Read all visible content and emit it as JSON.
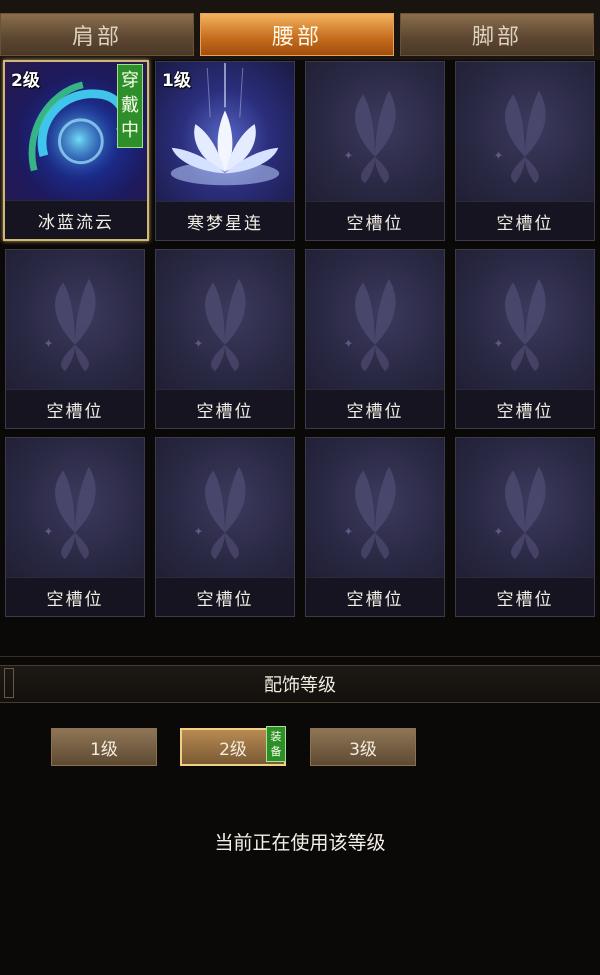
{
  "tabs": [
    {
      "label": "肩部"
    },
    {
      "label": "腰部"
    },
    {
      "label": "脚部"
    }
  ],
  "active_tab": "腰部",
  "slots": [
    {
      "name": "冰蓝流云",
      "level": "2级",
      "wearing": "穿戴中",
      "state": "equipped"
    },
    {
      "name": "寒梦星连",
      "level": "1级",
      "state": "owned"
    },
    {
      "name": "空槽位",
      "state": "empty"
    },
    {
      "name": "空槽位",
      "state": "empty"
    },
    {
      "name": "空槽位",
      "state": "empty"
    },
    {
      "name": "空槽位",
      "state": "empty"
    },
    {
      "name": "空槽位",
      "state": "empty"
    },
    {
      "name": "空槽位",
      "state": "empty"
    },
    {
      "name": "空槽位",
      "state": "empty"
    },
    {
      "name": "空槽位",
      "state": "empty"
    },
    {
      "name": "空槽位",
      "state": "empty"
    },
    {
      "name": "空槽位",
      "state": "empty"
    }
  ],
  "section": {
    "title": "配饰等级"
  },
  "levels": [
    {
      "label": "1级"
    },
    {
      "label": "2级",
      "badge": "装备"
    },
    {
      "label": "3级"
    }
  ],
  "active_level": "2级",
  "status_text": "当前正在使用该等级",
  "colors": {
    "active_tab": "#c56b1c",
    "equipped_badge": "#2e8f2a",
    "selected_border": "#d2b777"
  }
}
